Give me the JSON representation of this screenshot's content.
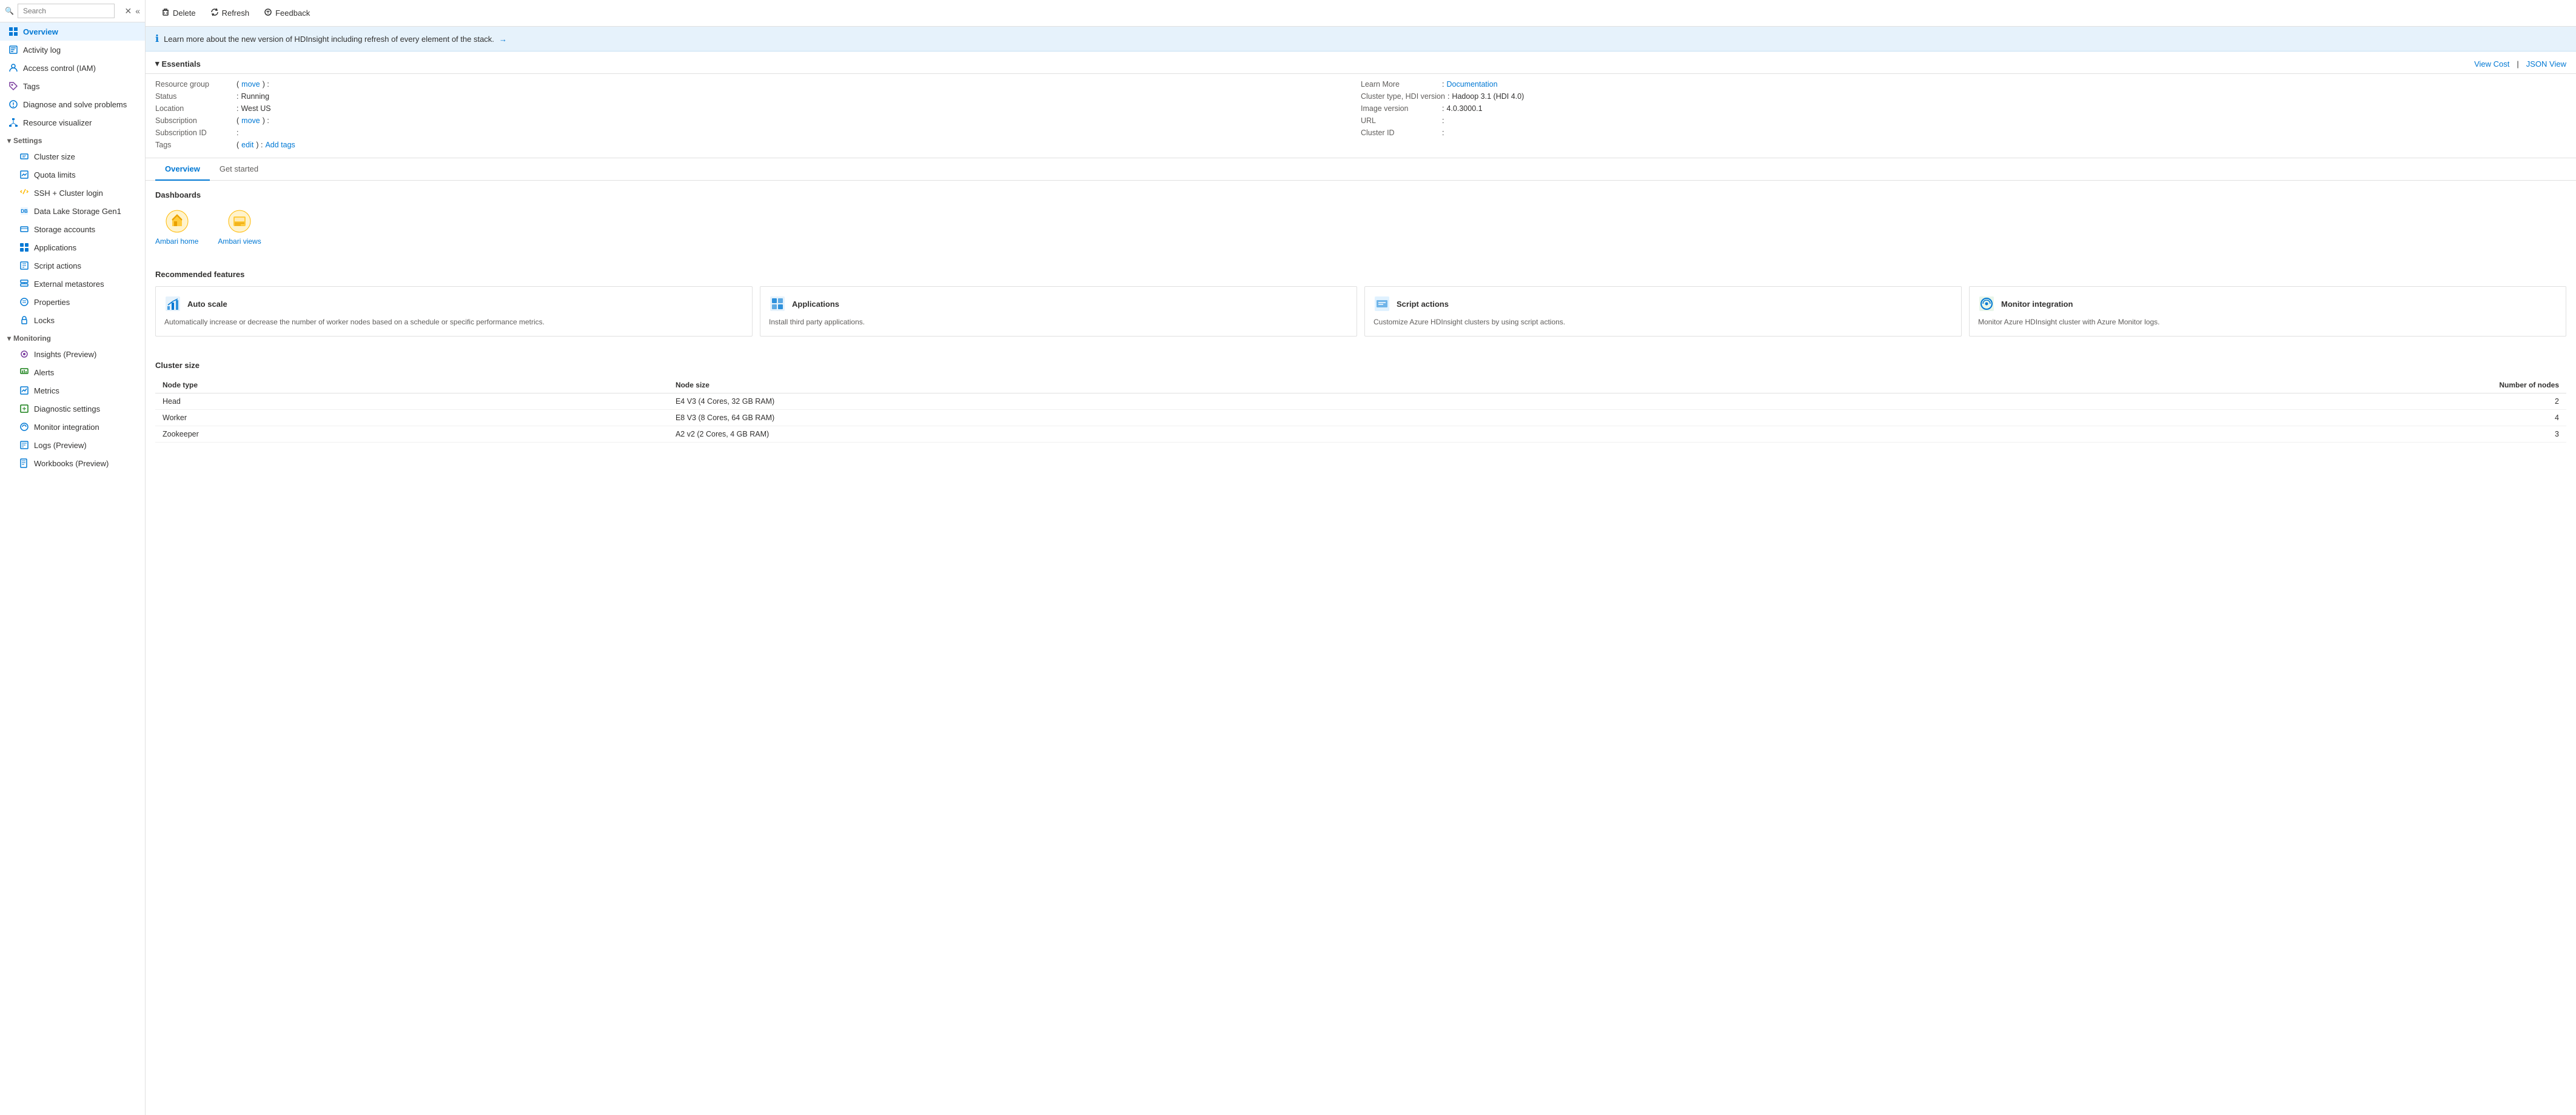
{
  "sidebar": {
    "search_placeholder": "Search",
    "items": [
      {
        "id": "overview",
        "label": "Overview",
        "icon": "overview",
        "active": true,
        "indent": false
      },
      {
        "id": "activity-log",
        "label": "Activity log",
        "icon": "activity",
        "active": false,
        "indent": false
      },
      {
        "id": "access-control",
        "label": "Access control (IAM)",
        "icon": "iam",
        "active": false,
        "indent": false
      },
      {
        "id": "tags",
        "label": "Tags",
        "icon": "tags",
        "active": false,
        "indent": false
      },
      {
        "id": "diagnose",
        "label": "Diagnose and solve problems",
        "icon": "diagnose",
        "active": false,
        "indent": false
      },
      {
        "id": "resource-visualizer",
        "label": "Resource visualizer",
        "icon": "resource",
        "active": false,
        "indent": false
      }
    ],
    "settings_section": "Settings",
    "settings_items": [
      {
        "id": "cluster-size",
        "label": "Cluster size",
        "icon": "cluster-size"
      },
      {
        "id": "quota-limits",
        "label": "Quota limits",
        "icon": "quota"
      },
      {
        "id": "ssh-login",
        "label": "SSH + Cluster login",
        "icon": "ssh"
      },
      {
        "id": "data-lake",
        "label": "Data Lake Storage Gen1",
        "icon": "data-lake"
      },
      {
        "id": "storage-accounts",
        "label": "Storage accounts",
        "icon": "storage"
      },
      {
        "id": "applications",
        "label": "Applications",
        "icon": "apps"
      },
      {
        "id": "script-actions",
        "label": "Script actions",
        "icon": "script"
      },
      {
        "id": "external-metastores",
        "label": "External metastores",
        "icon": "metastores"
      },
      {
        "id": "properties",
        "label": "Properties",
        "icon": "properties"
      },
      {
        "id": "locks",
        "label": "Locks",
        "icon": "locks"
      }
    ],
    "monitoring_section": "Monitoring",
    "monitoring_items": [
      {
        "id": "insights",
        "label": "Insights (Preview)",
        "icon": "insights"
      },
      {
        "id": "alerts",
        "label": "Alerts",
        "icon": "alerts"
      },
      {
        "id": "metrics",
        "label": "Metrics",
        "icon": "metrics"
      },
      {
        "id": "diagnostic",
        "label": "Diagnostic settings",
        "icon": "diagnostic"
      },
      {
        "id": "monitor-integration",
        "label": "Monitor integration",
        "icon": "monitor"
      },
      {
        "id": "logs",
        "label": "Logs (Preview)",
        "icon": "logs"
      },
      {
        "id": "workbooks",
        "label": "Workbooks (Preview)",
        "icon": "workbooks"
      }
    ]
  },
  "toolbar": {
    "delete_label": "Delete",
    "refresh_label": "Refresh",
    "feedback_label": "Feedback"
  },
  "banner": {
    "text": "Learn more about the new version of HDInsight including refresh of every element of the stack.",
    "arrow": "→"
  },
  "essentials": {
    "title": "Essentials",
    "view_cost": "View Cost",
    "json_view": "JSON View",
    "fields_left": [
      {
        "label": "Resource group",
        "value": "",
        "link": "move",
        "has_move": true
      },
      {
        "label": "Status",
        "value": "Running"
      },
      {
        "label": "Location",
        "value": "West US"
      },
      {
        "label": "Subscription",
        "value": "",
        "link": "move",
        "has_move": true
      },
      {
        "label": "Subscription ID",
        "value": ""
      },
      {
        "label": "Tags",
        "edit_link": "edit",
        "add_link": "Add tags"
      }
    ],
    "fields_right": [
      {
        "label": "Learn More",
        "value": "Documentation",
        "is_link": true
      },
      {
        "label": "Cluster type, HDI version",
        "value": "Hadoop 3.1 (HDI 4.0)"
      },
      {
        "label": "Image version",
        "value": "4.0.3000.1"
      },
      {
        "label": "URL",
        "value": ""
      },
      {
        "label": "Cluster ID",
        "value": ""
      }
    ]
  },
  "tabs": [
    {
      "id": "overview",
      "label": "Overview",
      "active": true
    },
    {
      "id": "get-started",
      "label": "Get started",
      "active": false
    }
  ],
  "dashboards": {
    "title": "Dashboards",
    "items": [
      {
        "id": "ambari-home",
        "label": "Ambari home"
      },
      {
        "id": "ambari-views",
        "label": "Ambari views"
      }
    ]
  },
  "recommended": {
    "title": "Recommended features",
    "cards": [
      {
        "id": "auto-scale",
        "title": "Auto scale",
        "description": "Automatically increase or decrease the number of worker nodes based on a schedule or specific performance metrics."
      },
      {
        "id": "applications",
        "title": "Applications",
        "description": "Install third party applications."
      },
      {
        "id": "script-actions",
        "title": "Script actions",
        "description": "Customize Azure HDInsight clusters by using script actions."
      },
      {
        "id": "monitor-integration",
        "title": "Monitor integration",
        "description": "Monitor Azure HDInsight cluster with Azure Monitor logs."
      }
    ]
  },
  "cluster_size": {
    "title": "Cluster size",
    "columns": [
      "Node type",
      "Node size",
      "Number of nodes"
    ],
    "rows": [
      {
        "node_type": "Head",
        "node_size": "E4 V3 (4 Cores, 32 GB RAM)",
        "num_nodes": "2"
      },
      {
        "node_type": "Worker",
        "node_size": "E8 V3 (8 Cores, 64 GB RAM)",
        "num_nodes": "4"
      },
      {
        "node_type": "Zookeeper",
        "node_size": "A2 v2 (2 Cores, 4 GB RAM)",
        "num_nodes": "3"
      }
    ]
  }
}
